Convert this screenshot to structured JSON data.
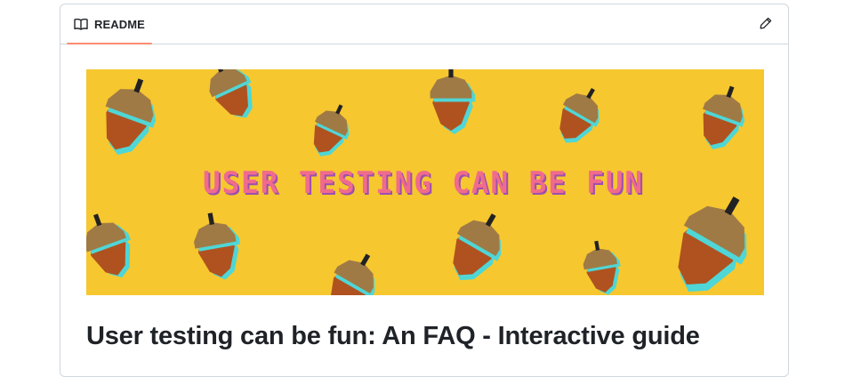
{
  "readme": {
    "tab_label": "README",
    "tab_icon": "book-icon",
    "edit_icon": "pencil-icon",
    "accent_color": "#fd8c73"
  },
  "banner": {
    "text": "USER TESTING CAN BE FUN",
    "background_color": "#f6c72f",
    "text_color": "#f06b8c",
    "shadow_color": "#9b4fb0",
    "decoration": "acorns"
  },
  "document": {
    "heading": "User testing can be fun: An FAQ - Interactive guide"
  }
}
